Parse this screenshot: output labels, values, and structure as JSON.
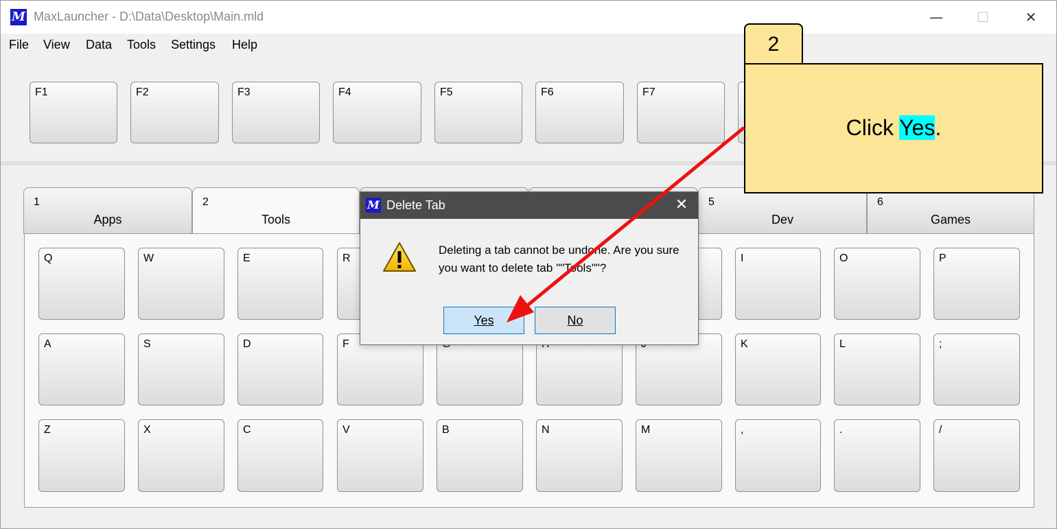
{
  "window": {
    "title": "MaxLauncher - D:\\Data\\Desktop\\Main.mld",
    "logo_letter": "M",
    "min_glyph": "—",
    "max_glyph": "☐",
    "close_glyph": "✕"
  },
  "menu": [
    {
      "label": "File"
    },
    {
      "label": "View"
    },
    {
      "label": "Data"
    },
    {
      "label": "Tools"
    },
    {
      "label": "Settings"
    },
    {
      "label": "Help"
    }
  ],
  "function_keys": [
    "F1",
    "F2",
    "F3",
    "F4",
    "F5",
    "F6",
    "F7"
  ],
  "tabs": [
    {
      "num": "1",
      "name": "Apps"
    },
    {
      "num": "2",
      "name": "Tools"
    },
    {
      "num": "5",
      "name": "Dev"
    },
    {
      "num": "6",
      "name": "Games"
    }
  ],
  "key_rows": [
    [
      "Q",
      "W",
      "E",
      "R",
      "",
      "",
      "",
      "I",
      "O",
      "P"
    ],
    [
      "A",
      "S",
      "D",
      "F",
      "G",
      "H",
      "J",
      "K",
      "L",
      ";"
    ],
    [
      "Z",
      "X",
      "C",
      "V",
      "B",
      "N",
      "M",
      ",",
      ".",
      "/"
    ]
  ],
  "dialog": {
    "title": "Delete Tab",
    "close_glyph": "✕",
    "message": "Deleting a tab cannot be undone. Are you sure you want to delete tab \"\"Tools\"\"?",
    "yes_label": "Yes",
    "no_label": "No"
  },
  "callout": {
    "step": "2",
    "text_before": "Click ",
    "text_highlight": "Yes",
    "text_after": ".",
    "highlight_color": "#00ffff",
    "bg_color": "#fde597",
    "arrow_color": "#ee1111"
  }
}
